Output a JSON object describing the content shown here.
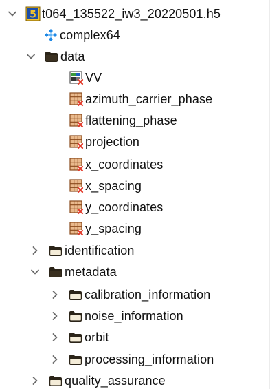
{
  "tree": {
    "root": {
      "label": "t064_135522_iw3_20220501.h5",
      "expanded": true,
      "icon": "hdf5-file-icon"
    },
    "datatype": {
      "label": "complex64",
      "icon": "datatype-icon"
    },
    "data": {
      "label": "data",
      "expanded": true,
      "icon": "folder-open-icon",
      "children": [
        {
          "label": "VV",
          "icon": "image-dataset-icon"
        },
        {
          "label": "azimuth_carrier_phase",
          "icon": "dataset-icon"
        },
        {
          "label": "flattening_phase",
          "icon": "dataset-icon"
        },
        {
          "label": "projection",
          "icon": "dataset-icon"
        },
        {
          "label": "x_coordinates",
          "icon": "dataset-icon"
        },
        {
          "label": "x_spacing",
          "icon": "dataset-icon"
        },
        {
          "label": "y_coordinates",
          "icon": "dataset-icon"
        },
        {
          "label": "y_spacing",
          "icon": "dataset-icon"
        }
      ]
    },
    "identification": {
      "label": "identification",
      "expanded": false,
      "icon": "folder-closed-icon"
    },
    "metadata": {
      "label": "metadata",
      "expanded": true,
      "icon": "folder-open-icon",
      "children": [
        {
          "label": "calibration_information",
          "expanded": false,
          "icon": "folder-closed-icon"
        },
        {
          "label": "noise_information",
          "expanded": false,
          "icon": "folder-closed-icon"
        },
        {
          "label": "orbit",
          "expanded": false,
          "icon": "folder-closed-icon"
        },
        {
          "label": "processing_information",
          "expanded": false,
          "icon": "folder-closed-icon"
        }
      ]
    },
    "quality_assurance": {
      "label": "quality_assurance",
      "expanded": false,
      "icon": "folder-closed-icon"
    }
  },
  "colors": {
    "hdf5_yellow": "#f2c230",
    "hdf5_blue": "#1d4ea8",
    "datatype_blue": "#1e88e5",
    "folder_dark": "#2b2418",
    "folder_fill": "#f4ecd8",
    "dataset_brown": "#b5672e",
    "dataset_red": "#e23a2a",
    "chevron": "#6b6b6b"
  }
}
